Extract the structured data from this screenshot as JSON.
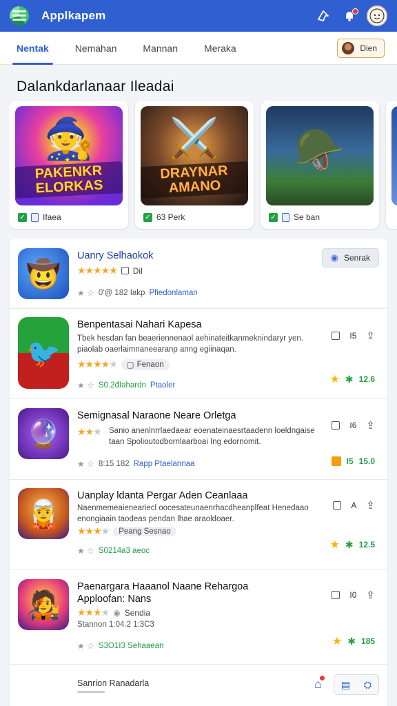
{
  "header": {
    "app_title": "Applkapem",
    "icons": [
      "logo-icon",
      "share-icon",
      "notification-icon",
      "avatar"
    ]
  },
  "tabs": [
    {
      "label": "Nentak",
      "active": true
    },
    {
      "label": "Nemahan",
      "active": false
    },
    {
      "label": "Mannan",
      "active": false
    },
    {
      "label": "Meraka",
      "active": false
    }
  ],
  "tab_button": {
    "label": "Dien"
  },
  "section": {
    "title": "Dalankdarlanaar Ileadai"
  },
  "featured": [
    {
      "banner": "PAKENKR ELORKAS",
      "foot": "Ifaea",
      "colors": [
        "#6a2bd8",
        "#e83fa0",
        "#f7b731"
      ],
      "icon": "wizard-icon"
    },
    {
      "banner": "DRAYNAR AMANO",
      "foot": "63 Perk",
      "colors": [
        "#3b2a22",
        "#7b4a2b",
        "#c9873f"
      ],
      "icon": "warrior-icon"
    },
    {
      "banner": "",
      "foot": "Se ban",
      "colors": [
        "#1f3a5f",
        "#3b7d3a",
        "#d8a64a"
      ],
      "icon": "soldier-icon"
    }
  ],
  "list": [
    {
      "title": "Uanry Selhaokok",
      "stars": 5,
      "rating_text": "Dil",
      "meta": "0'@ 182 Iakp",
      "meta_link": "Pfiedonlaman",
      "button": "Senrak",
      "icon": "adventurer-icon"
    },
    {
      "title": "Benpentasai Nahari Kapesa",
      "desc": "Tbek hesdan fan beaeriennenaol aehinateitkanmeknindaryr yen. piaolab oaerlaimnaneearanp anng egiinaqan.",
      "stars": 4,
      "pill": "Fenaon",
      "meta": "S0.2đIahardn",
      "meta_link": "Ptaoler",
      "count": "I5",
      "score": "12.6",
      "icon": "bird-game-icon"
    },
    {
      "title": "Semignasal Naraone Neare Orletga",
      "desc": "Sanio anenlnrrlaedaear eoenateinaesrtaadenn loeldngaise taan Spolioutodbornlaarboai Ing edornomit.",
      "stars": 3,
      "meta": "8:15 182",
      "meta_link": "Rapp Ptaelannaa",
      "count": "I6",
      "score": "15.0",
      "score_mid": "I5",
      "icon": "orb-icon"
    },
    {
      "title": "Uanplay ldanta Pergar Aden Ceanlaaa",
      "desc": "Naenmemeaieneariecl oocesateunaenrhacdheanplfeat Henedaao enongiaain taodeas pendan lhae araoldoaer.",
      "stars": 3,
      "pill": "Peang Sesnao",
      "meta": "S0214a3 aeoc",
      "count": "A",
      "score": "12.5",
      "icon": "hero-icon"
    },
    {
      "title": "Paenargara Haaanol Naane Rehargoa Apploofan: Nans",
      "stars": 3,
      "pill": "Sendia",
      "sub": "Stannon 1:04.2 1:3C3",
      "meta": "S3O1I3 Sehaaean",
      "count": "I0",
      "score": "185",
      "icon": "viking-icon"
    }
  ],
  "bottom": {
    "label": "Sanrion Ranadarla"
  }
}
